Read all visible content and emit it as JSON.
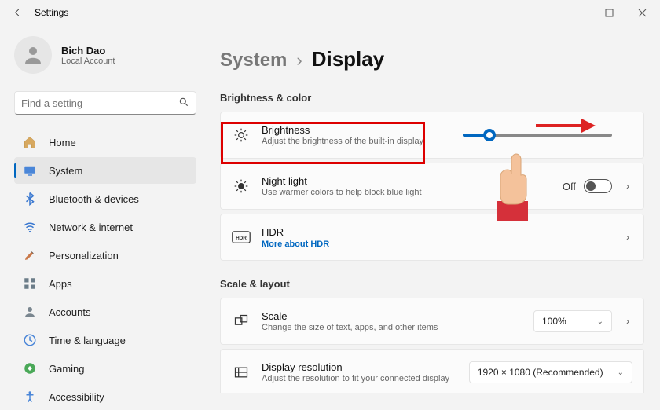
{
  "titlebar": {
    "title": "Settings"
  },
  "user": {
    "name": "Bich Dao",
    "sub": "Local Account"
  },
  "search": {
    "placeholder": "Find a setting"
  },
  "sidebar": {
    "items": [
      {
        "label": "Home"
      },
      {
        "label": "System"
      },
      {
        "label": "Bluetooth & devices"
      },
      {
        "label": "Network & internet"
      },
      {
        "label": "Personalization"
      },
      {
        "label": "Apps"
      },
      {
        "label": "Accounts"
      },
      {
        "label": "Time & language"
      },
      {
        "label": "Gaming"
      },
      {
        "label": "Accessibility"
      }
    ]
  },
  "breadcrumb": {
    "parent": "System",
    "current": "Display"
  },
  "sections": {
    "bc_title": "Brightness & color",
    "brightness": {
      "label": "Brightness",
      "sub": "Adjust the brightness of the built-in display",
      "slider_pct": 18
    },
    "nightlight": {
      "label": "Night light",
      "sub": "Use warmer colors to help block blue light",
      "state": "Off"
    },
    "hdr": {
      "label": "HDR",
      "link": "More about HDR"
    },
    "sl_title": "Scale & layout",
    "scale": {
      "label": "Scale",
      "sub": "Change the size of text, apps, and other items",
      "value": "100%"
    },
    "resolution": {
      "label": "Display resolution",
      "sub": "Adjust the resolution to fit your connected display",
      "value": "1920 × 1080 (Recommended)"
    }
  }
}
